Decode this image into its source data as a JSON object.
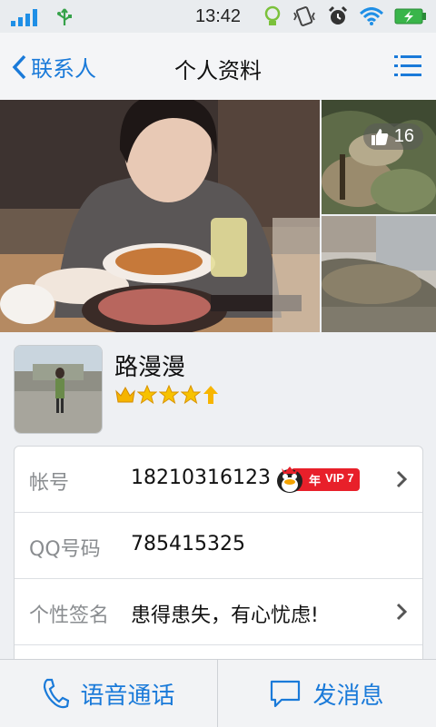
{
  "status_bar": {
    "time": "13:42"
  },
  "nav": {
    "back_label": "联系人",
    "title": "个人资料"
  },
  "photos": {
    "like_count": "16"
  },
  "profile": {
    "name": "路漫漫"
  },
  "info": {
    "rows": [
      {
        "label": "帐号",
        "value": "18210316123"
      },
      {
        "label": "QQ号码",
        "value": "785415325"
      },
      {
        "label": "个性签名",
        "value": "患得患失，有心忧虑!"
      }
    ],
    "vip": {
      "year_label": "年",
      "vip_label": "VIP 7"
    }
  },
  "bottom": {
    "voice_call_label": "语音通话",
    "message_label": "发消息"
  },
  "colors": {
    "accent": "#1a7ad9",
    "vip_red": "#e8202a"
  }
}
